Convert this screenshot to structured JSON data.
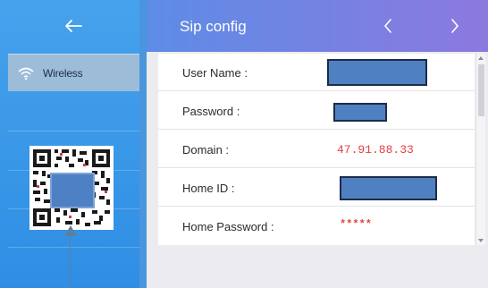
{
  "header": {
    "title": "Sip config",
    "back_icon": "arrow-left-icon",
    "prev_icon": "chevron-left-icon",
    "next_icon": "chevron-right-icon"
  },
  "sidebar": {
    "items": [
      {
        "label": "Wireless",
        "icon": "wifi-icon"
      }
    ]
  },
  "form": {
    "rows": [
      {
        "label": "User Name :",
        "value": ""
      },
      {
        "label": "Password :",
        "value": ""
      },
      {
        "label": "Domain :",
        "value": "47.91.88.33"
      },
      {
        "label": "Home ID :",
        "value": ""
      },
      {
        "label": "Home Password :",
        "value": "*****"
      }
    ]
  },
  "colors": {
    "accent_start": "#5d8ce6",
    "accent_end": "#8c79df",
    "sidebar": "#3b98e8",
    "value_red": "#e34141"
  }
}
